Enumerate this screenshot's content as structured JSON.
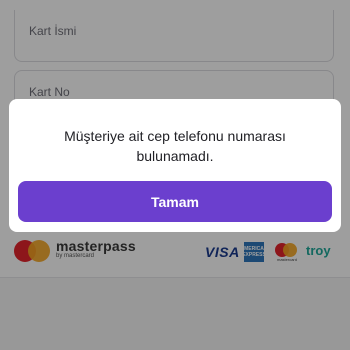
{
  "form": {
    "card_name_label": "Kart İsmi",
    "card_number_label": "Kart No"
  },
  "branding": {
    "masterpass_word": "masterpass",
    "masterpass_sub": "by mastercard",
    "visa": "VISA",
    "amex": "AMERICAN EXPRESS",
    "mastercard_small": "mastercard",
    "troy": "troy"
  },
  "dialog": {
    "message": "Müşteriye ait cep telefonu numarası bulunamadı.",
    "ok_label": "Tamam"
  },
  "colors": {
    "accent": "#6b3fce",
    "overlay": "rgba(0,0,0,0.38)"
  }
}
